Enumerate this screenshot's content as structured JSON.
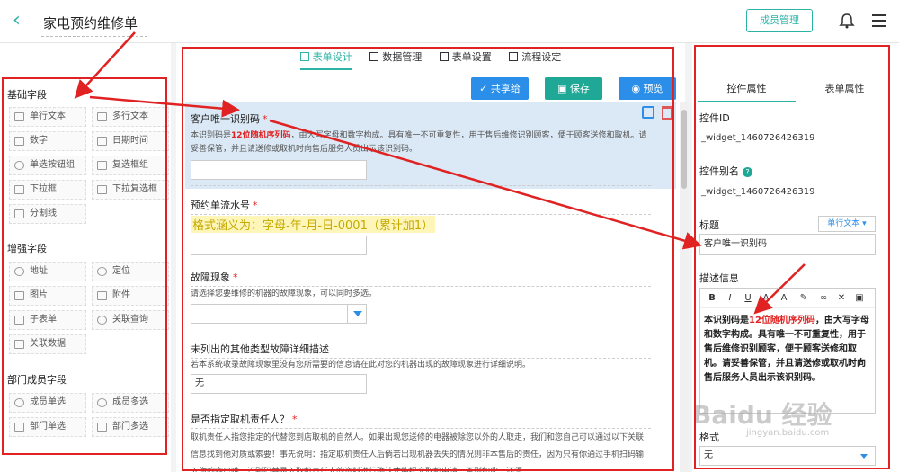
{
  "header": {
    "title": "家电预约维修单",
    "members_button": "成员管理"
  },
  "tabs": [
    {
      "label": "表单设计",
      "active": true
    },
    {
      "label": "数据管理"
    },
    {
      "label": "表单设置"
    },
    {
      "label": "流程设定"
    }
  ],
  "actions": {
    "share": "共享给",
    "save": "保存",
    "preview": "预览"
  },
  "sidebar": {
    "basic_title": "基础字段",
    "basic": [
      "单行文本",
      "多行文本",
      "数字",
      "日期时间",
      "单选按钮组",
      "复选框组",
      "下拉框",
      "下拉复选框",
      "分割线"
    ],
    "enhanced_title": "增强字段",
    "enhanced": [
      "地址",
      "定位",
      "图片",
      "附件",
      "子表单",
      "关联查询",
      "关联数据"
    ],
    "dept_title": "部门成员字段",
    "dept": [
      "成员单选",
      "成员多选",
      "部门单选",
      "部门多选"
    ]
  },
  "form": {
    "f1": {
      "label": "客户唯一识别码",
      "req": "*",
      "desc_pre": "本识别码是",
      "desc_hl": "12位随机序列码",
      "desc_post": "，由大写字母和数字构成。具有唯一不可重复性，用于售后维修识别顾客，便于顾客送修和取机。请妥善保管，并且请送修或取机时向售后服务人员出示该识别码。"
    },
    "f2": {
      "label": "预约单流水号",
      "req": "*",
      "note": "格式涵义为：字母-年-月-日-0001（累计加1）"
    },
    "f3": {
      "label": "故障现象",
      "req": "*",
      "desc": "请选择您要维修的机器的故障现象，可以同时多选。"
    },
    "f4": {
      "label": "未列出的其他类型故障详细描述",
      "desc": "若本系统收录故障现象里没有您所需要的信息请在此对您的机器出现的故障现象进行详细说明。",
      "value": "无"
    },
    "f5": {
      "label": "是否指定取机责任人？",
      "req": "*",
      "desc": "取机责任人指您指定的代替您到店取机的自然人。如果出现您送修的电器被除您以外的人取走，我们和您自己可以通过以下关联信息找到他对质或索要！事先说明：指定取机责任人后倘若出现机器丢失的情况则非本售后的责任，因为只有你通过手机扫码输入你的客户唯一识别码并录入取机责任人的资料进行确认才能提交取机申请，否则如此，还须"
    }
  },
  "props": {
    "tab_control": "控件属性",
    "tab_form": "表单属性",
    "id_label": "控件ID",
    "id_value": "_widget_1460726426319",
    "alias_label": "控件别名",
    "alias_value": "_widget_1460726426319",
    "title_label": "标题",
    "type_value": "单行文本",
    "title_value": "客户唯一识别码",
    "desc_label": "描述信息",
    "toolbar": [
      "B",
      "I",
      "U",
      "A",
      "A"
    ],
    "desc_pre": "本识别码是",
    "desc_hl": "12位随机序列码",
    "desc_post": "，由大写字母和数字构成。具有唯一不可重复性，用于售后维修识别顾客，便于顾客送修和取机。请妥善保管，并且请送修或取机时向售后服务人员出示该识别码。",
    "format_label": "格式",
    "format_value": "无"
  },
  "watermark": {
    "main": "Baidu 经验",
    "sub": "jingyan.baidu.com"
  }
}
